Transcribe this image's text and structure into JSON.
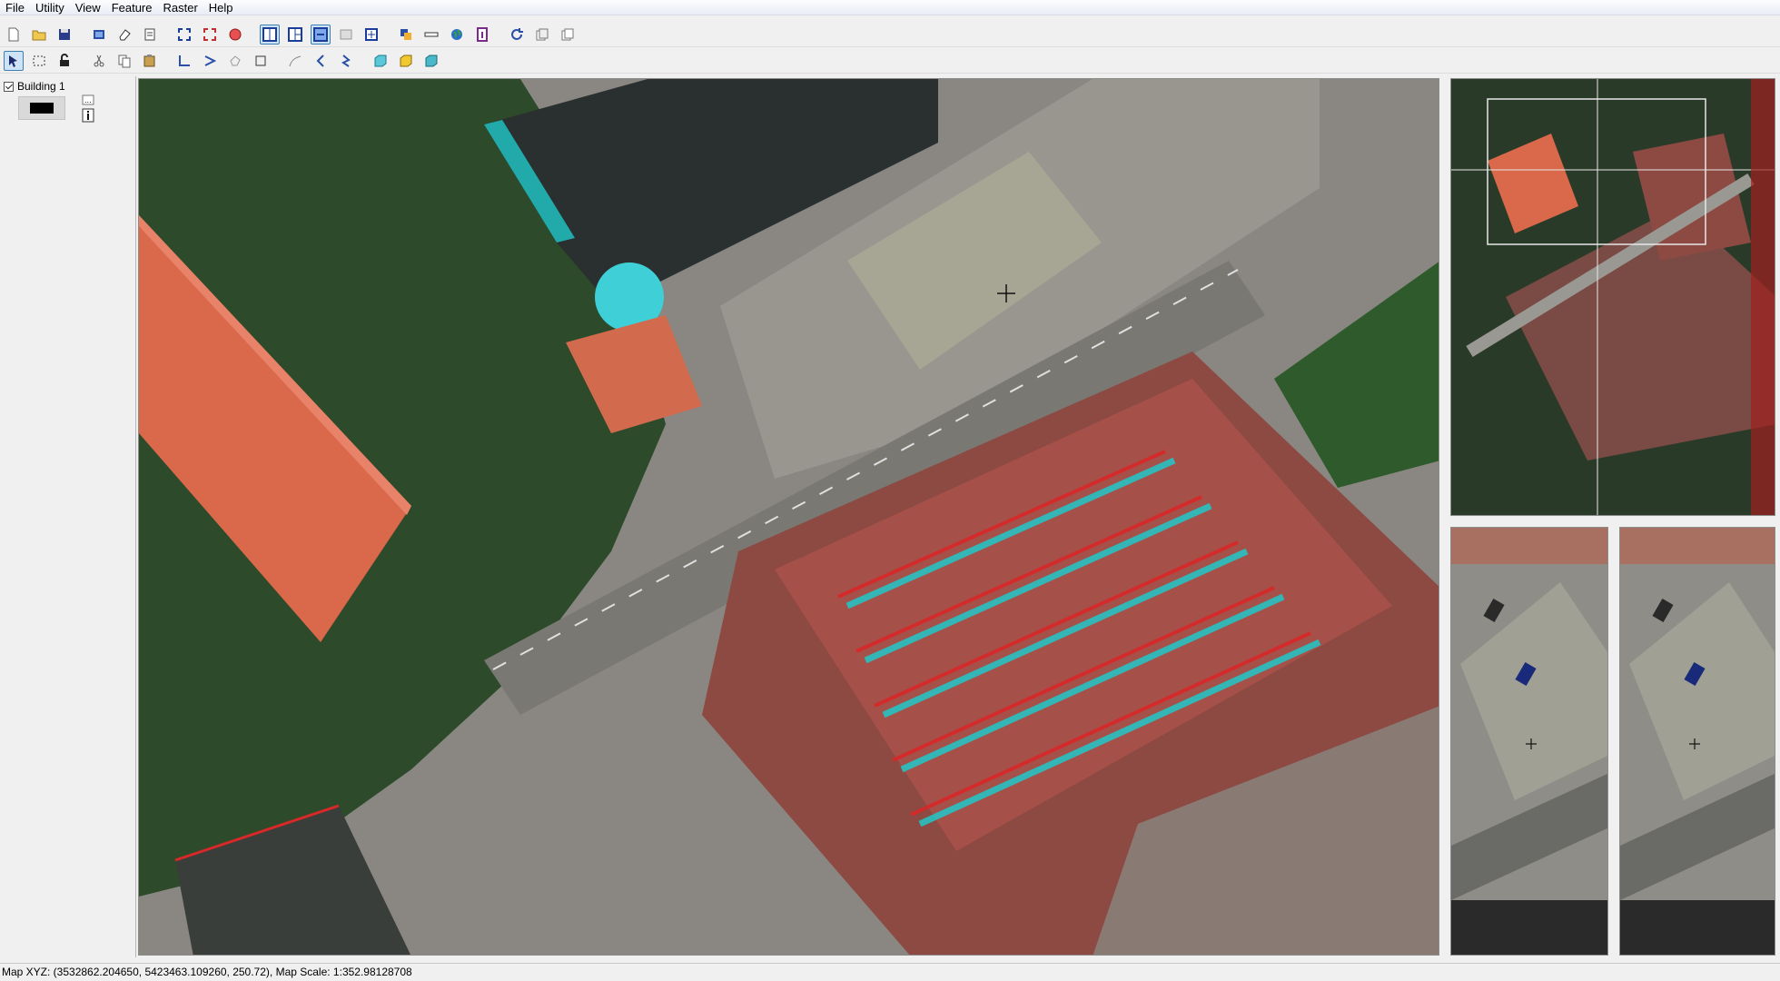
{
  "menu": [
    "File",
    "Utility",
    "View",
    "Feature",
    "Raster",
    "Help"
  ],
  "toolbar1": [
    "new-file-icon",
    "open-folder-icon",
    "save-icon",
    "open-project-icon",
    "eraser-icon",
    "properties-icon",
    "zoom-extent-icon",
    "zoom-full-icon",
    "clear-icon",
    "layout-split-icon",
    "layout-tile-icon",
    "layout-stereo-icon",
    "layout-grid-icon",
    "crosshair-frame-icon",
    "layers-icon",
    "measure-icon",
    "globe-icon",
    "info-book-icon",
    "refresh-icon",
    "copy-window-icon",
    "paste-window-icon"
  ],
  "toolbar2": [
    "select-pointer-icon",
    "select-rectangle-icon",
    "lock-icon",
    "cut-icon",
    "copy-icon",
    "paste-icon",
    "corner-line-icon",
    "snap-line-icon",
    "polygon-icon",
    "rectangle-icon",
    "curve-icon",
    "arc-icon",
    "zigzag-icon",
    "box-3d-icon",
    "box-3d-yellow-icon",
    "box-3d-cyan-icon"
  ],
  "layers": [
    {
      "label": "Building 1",
      "checked": true,
      "color": "#000000"
    }
  ],
  "status": {
    "text": "Map XYZ: (3532862.204650, 5423463.109260, 250.72), Map Scale: 1:352.98128708"
  },
  "colors": {
    "anaglyph_red": "#d82828",
    "anaglyph_cyan": "#20c8c8",
    "roof_orange": "#d9694a",
    "tree_green": "#2d4a2a",
    "pavement": "#8e8b86"
  }
}
